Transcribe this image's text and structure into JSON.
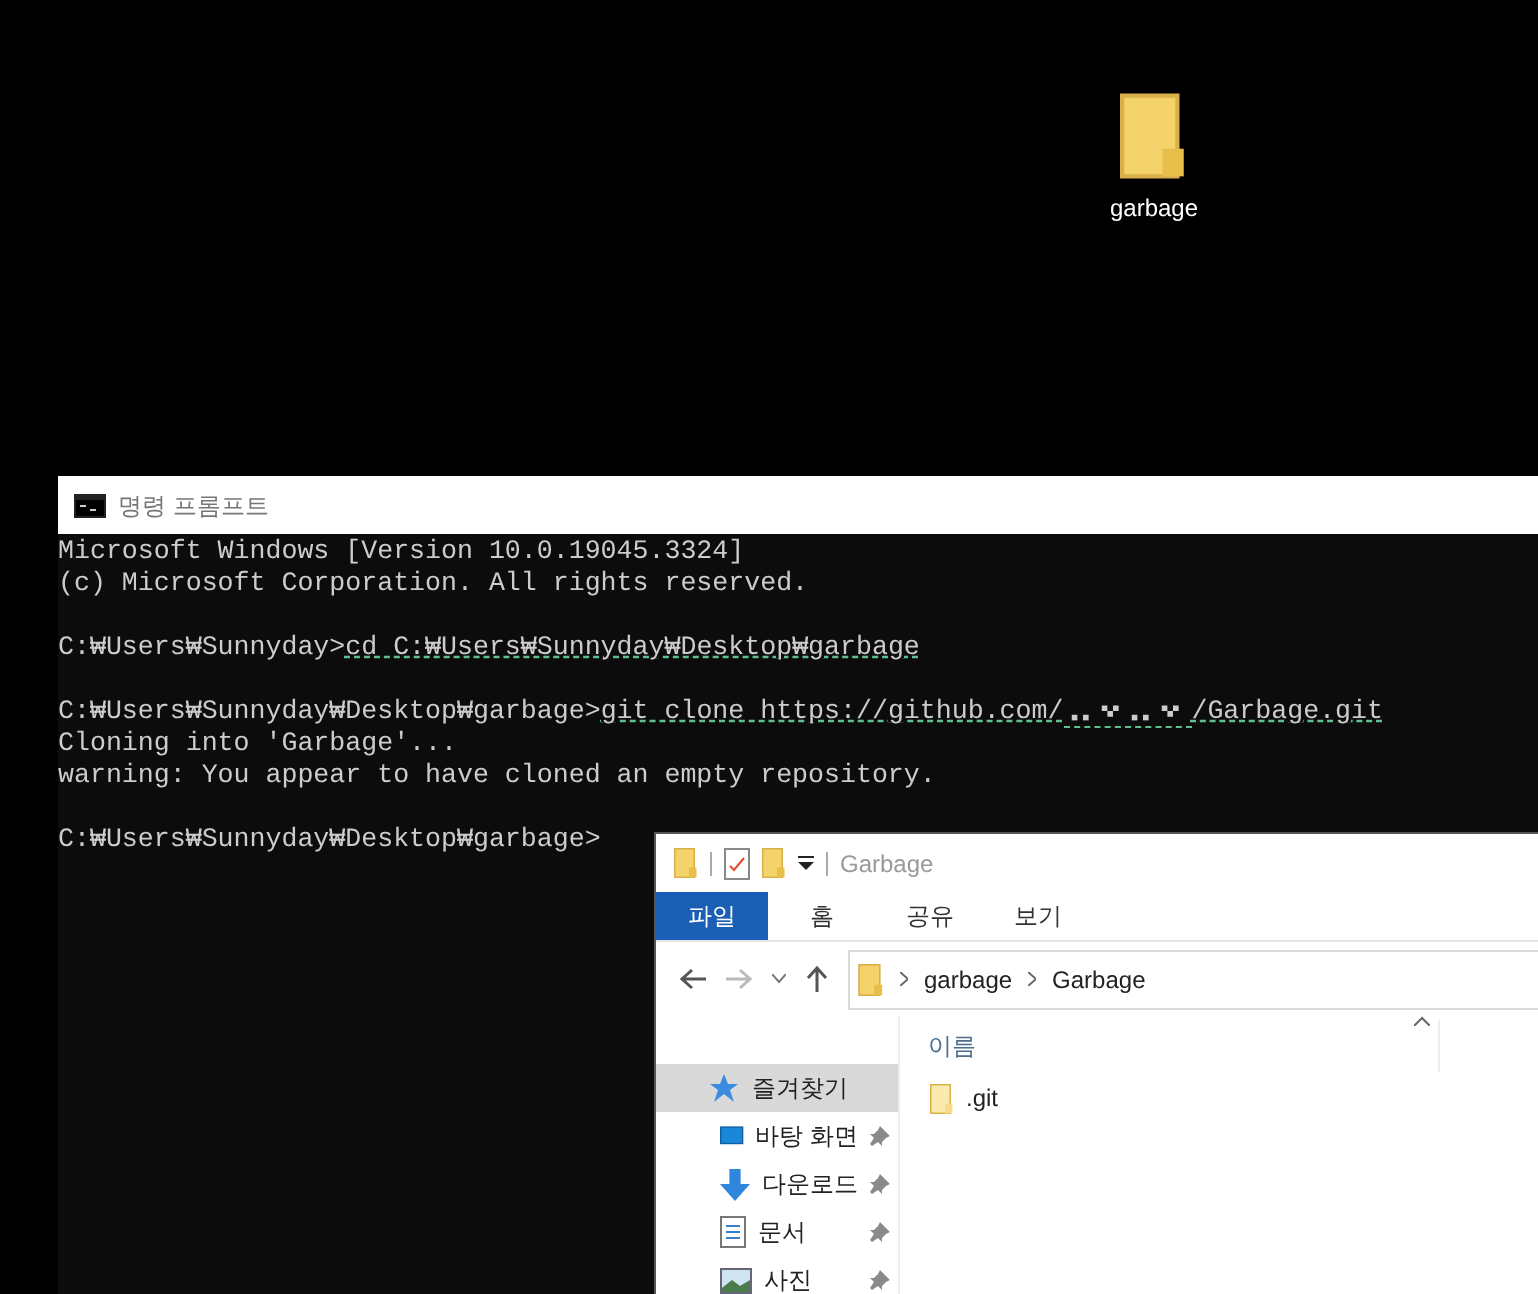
{
  "desktop_icons": [
    {
      "label": "garbage"
    }
  ],
  "console": {
    "title": "명령 프롬프트",
    "lines": [
      {
        "kind": "text",
        "text": "Microsoft Windows [Version 10.0.19045.3324]"
      },
      {
        "kind": "text",
        "text": "(c) Microsoft Corporation. All rights reserved."
      },
      {
        "kind": "blank"
      },
      {
        "kind": "command",
        "prompt": "C:₩Users₩Sunnyday>",
        "command": [
          {
            "kind": "text",
            "text": "cd C:₩Users₩Sunnyday₩Desktop₩garbage"
          }
        ]
      },
      {
        "kind": "blank"
      },
      {
        "kind": "command",
        "prompt": "C:₩Users₩Sunnyday₩Desktop₩garbage>",
        "command": [
          {
            "kind": "text",
            "text": "git clone https://github.com/"
          },
          {
            "kind": "redacted"
          },
          {
            "kind": "text",
            "text": "/Garbage.git"
          }
        ]
      },
      {
        "kind": "text",
        "text": "Cloning into 'Garbage'..."
      },
      {
        "kind": "text",
        "text": "warning: You appear to have cloned an empty repository."
      },
      {
        "kind": "blank"
      },
      {
        "kind": "prompt",
        "text": "C:₩Users₩Sunnyday₩Desktop₩garbage>"
      }
    ]
  },
  "explorer": {
    "title": "Garbage",
    "ribbon_tabs": [
      {
        "label": "파일",
        "selected": true
      },
      {
        "label": "홈",
        "selected": false
      },
      {
        "label": "공유",
        "selected": false
      },
      {
        "label": "보기",
        "selected": false
      }
    ],
    "breadcrumb": [
      "garbage",
      "Garbage"
    ],
    "nav": [
      {
        "label": "즐겨찾기",
        "kind": "star",
        "selected": true,
        "pinned": false
      },
      {
        "label": "바탕 화면",
        "kind": "desktop",
        "selected": false,
        "pinned": true
      },
      {
        "label": "다운로드",
        "kind": "download",
        "selected": false,
        "pinned": true
      },
      {
        "label": "문서",
        "kind": "document",
        "selected": false,
        "pinned": true
      },
      {
        "label": "사진",
        "kind": "picture",
        "selected": false,
        "pinned": true
      }
    ],
    "columns": [
      "이름"
    ],
    "files": [
      {
        "name": ".git"
      }
    ]
  }
}
